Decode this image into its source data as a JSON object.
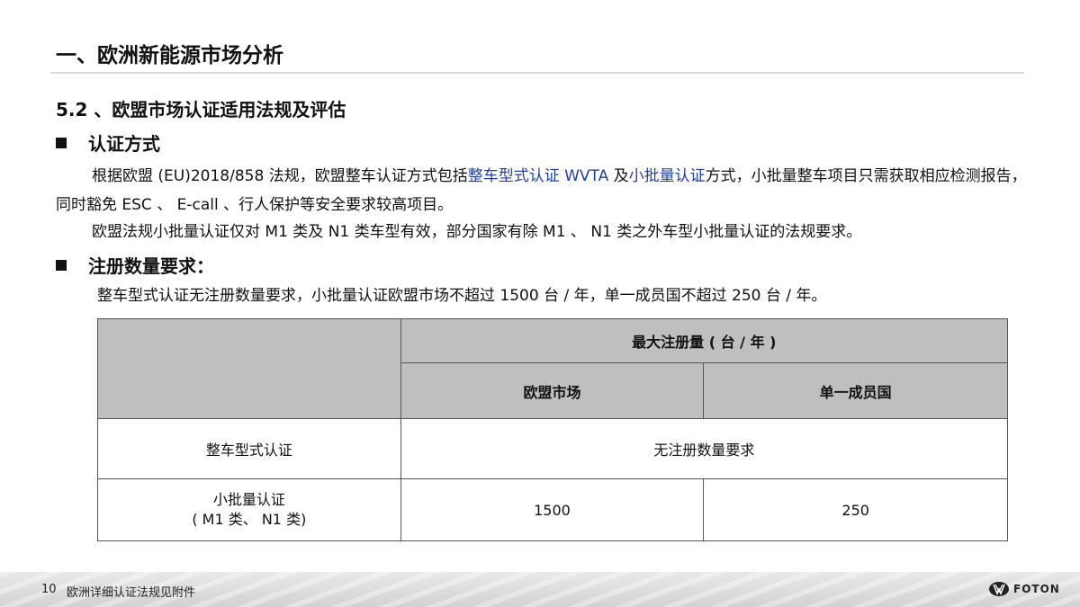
{
  "page_title": "一、欧洲新能源市场分析",
  "section_heading": "5.2 、欧盟市场认证适用法规及评估",
  "certification": {
    "heading": "认证方式",
    "p1_before": "根据欧盟 (EU)2018/858 法规，欧盟整车认证方式包括",
    "p1_link1": "整车型式认证 WVTA",
    "p1_mid": " 及",
    "p1_link2": "小批量认证",
    "p1_after": "方式，小批量整车项目只需获取相应检测报告，同时豁免 ESC 、 E-call 、行人保护等安全要求较高项目。",
    "p2": "欧盟法规小批量认证仅对 M1 类及 N1 类车型有效，部分国家有除 M1 、 N1 类之外车型小批量认证的法规要求。"
  },
  "registration": {
    "heading": "注册数量要求：",
    "text": "整车型式认证无注册数量要求，小批量认证欧盟市场不超过 1500 台 / 年，单一成员国不超过 250 台 / 年。"
  },
  "table": {
    "header_group": "最大注册量 ( 台 / 年 )",
    "col_eu": "欧盟市场",
    "col_member": "单一成员国",
    "row1_label": "整车型式认证",
    "row1_value": "无注册数量要求",
    "row2_label_line1": "小批量认证",
    "row2_label_line2": "( M1 类、 N1 类)",
    "row2_eu": "1500",
    "row2_member": "250"
  },
  "footer": {
    "page_number": "10",
    "text": "欧洲详细认证法规见附件",
    "logo_text": "FOTON"
  },
  "colors": {
    "highlight": "#1f3fa8",
    "table_header": "#bfbfbf"
  }
}
